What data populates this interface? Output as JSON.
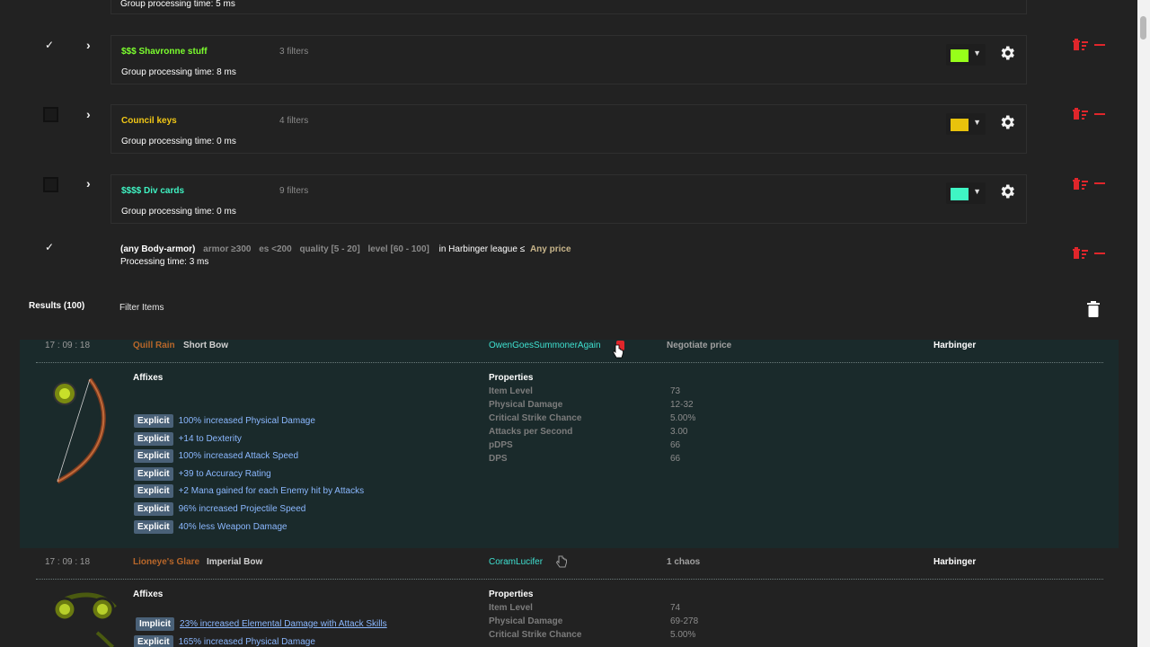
{
  "top_group": {
    "processing": "Group processing time: 5 ms"
  },
  "groups": [
    {
      "name": "$$$ Shavronne stuff",
      "name_color": "#7cff2e",
      "filters": "3 filters",
      "processing": "Group processing time: 8 ms",
      "checked": true,
      "swatch": "#97ff1a"
    },
    {
      "name": "Council keys",
      "name_color": "#f2c816",
      "filters": "4 filters",
      "processing": "Group processing time: 0 ms",
      "checked": false,
      "swatch": "#e8c20c"
    },
    {
      "name": "$$$$ Div cards",
      "name_color": "#3ff2c2",
      "filters": "9 filters",
      "processing": "Group processing time: 0 ms",
      "checked": false,
      "swatch": "#3ff6c4"
    }
  ],
  "filter": {
    "name": "(any Body-armor)",
    "conditions": [
      "armor ≥300",
      "es <200",
      "quality [5 - 20]",
      "level [60 - 100]"
    ],
    "league": "in Harbinger league ≤",
    "price": "Any price",
    "processing": "Processing time: 3 ms"
  },
  "results_header": {
    "results_label": "Results (100)",
    "filter_items_label": "Filter Items"
  },
  "results": [
    {
      "time": "17 : 09 : 18",
      "item_name": "Quill Rain",
      "base_type": "Short Bow",
      "seller": "OwenGoesSummonerAgain",
      "price": "Negotiate price",
      "league": "Harbinger",
      "affixes_title": "Affixes",
      "affixes": [
        {
          "kind": "Explicit",
          "text": "100% increased Physical Damage"
        },
        {
          "kind": "Explicit",
          "text": "+14 to Dexterity"
        },
        {
          "kind": "Explicit",
          "text": "100% increased Attack Speed"
        },
        {
          "kind": "Explicit",
          "text": "+39 to Accuracy Rating"
        },
        {
          "kind": "Explicit",
          "text": "+2 Mana gained for each Enemy hit by Attacks"
        },
        {
          "kind": "Explicit",
          "text": "96% increased Projectile Speed"
        },
        {
          "kind": "Explicit",
          "text": "40% less Weapon Damage"
        }
      ],
      "properties_title": "Properties",
      "properties": [
        {
          "key": "Item Level",
          "value": "73"
        },
        {
          "key": "Physical Damage",
          "value": "12-32"
        },
        {
          "key": "Critical Strike Chance",
          "value": "5.00%"
        },
        {
          "key": "Attacks per Second",
          "value": "3.00"
        },
        {
          "key": "pDPS",
          "value": "66"
        },
        {
          "key": "DPS",
          "value": "66"
        }
      ]
    },
    {
      "time": "17 : 09 : 18",
      "item_name": "Lioneye's Glare",
      "base_type": "Imperial Bow",
      "seller": "CoramLucifer",
      "price": "1 chaos",
      "league": "Harbinger",
      "affixes_title": "Affixes",
      "affixes": [
        {
          "kind": "Implicit",
          "text": "23% increased Elemental Damage with Attack Skills"
        },
        {
          "kind": "Explicit",
          "text": "165% increased Physical Damage"
        }
      ],
      "properties_title": "Properties",
      "properties": [
        {
          "key": "Item Level",
          "value": "74"
        },
        {
          "key": "Physical Damage",
          "value": "69-278"
        },
        {
          "key": "Critical Strike Chance",
          "value": "5.00%"
        }
      ]
    }
  ]
}
